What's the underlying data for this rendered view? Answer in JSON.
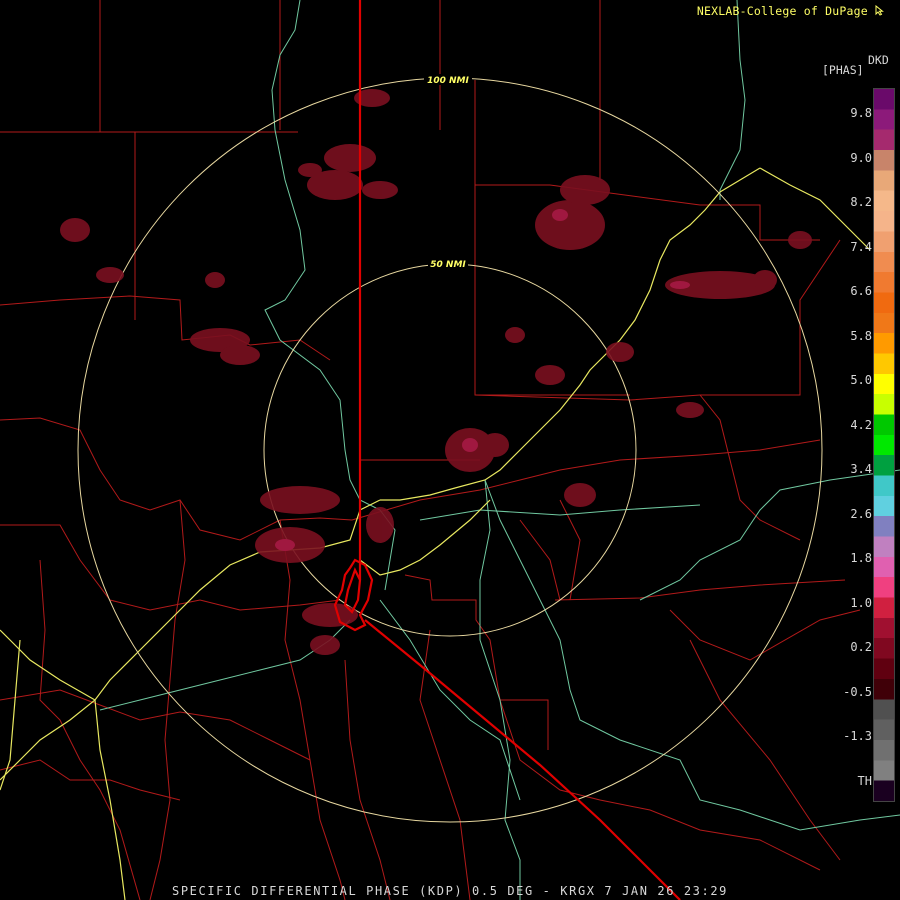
{
  "credit": "NEXLAB-College of DuPage",
  "credit_icon": "mouse-cursor-icon",
  "product_unit_top": "DKD",
  "product_unit_bottom": "[PHAS]",
  "scale_labels": [
    "9.8",
    "9.0",
    "8.2",
    "7.4",
    "6.6",
    "5.8",
    "5.0",
    "4.2",
    "3.4",
    "2.6",
    "1.8",
    "1.0",
    "0.2",
    "-0.5",
    "-1.3",
    "TH"
  ],
  "colorbar_colors": [
    "#6a0a6a",
    "#8c1a7a",
    "#a52a6e",
    "#c8846a",
    "#e8a878",
    "#f5b88a",
    "#f5b48a",
    "#f0a070",
    "#f08c50",
    "#f07a30",
    "#f06a10",
    "#f07818",
    "#ff9a00",
    "#ffc800",
    "#ffff00",
    "#c8ff00",
    "#00c800",
    "#00e800",
    "#00a040",
    "#40c8c8",
    "#60d0e0",
    "#8080c0",
    "#c080c0",
    "#e060b0",
    "#f04080",
    "#d02040",
    "#a01030",
    "#800820",
    "#600010",
    "#400008",
    "#505050",
    "#606060",
    "#707070",
    "#808080",
    "#1a0020"
  ],
  "range_rings": [
    {
      "label": "100 NMI"
    },
    {
      "label": "50 NMI"
    }
  ],
  "caption": "SPECIFIC DIFFERENTIAL PHASE (KDP) 0.5 DEG - KRGX 7 JAN 26 23:29",
  "colors": {
    "background": "#000000",
    "county_lines": "#b21a1a",
    "state_line": "#e00000",
    "highways": "#e8e860",
    "rivers": "#70c8a0",
    "range_rings": "#e8d8a0",
    "echo": "#7a1020",
    "echo_high": "#a01840"
  }
}
